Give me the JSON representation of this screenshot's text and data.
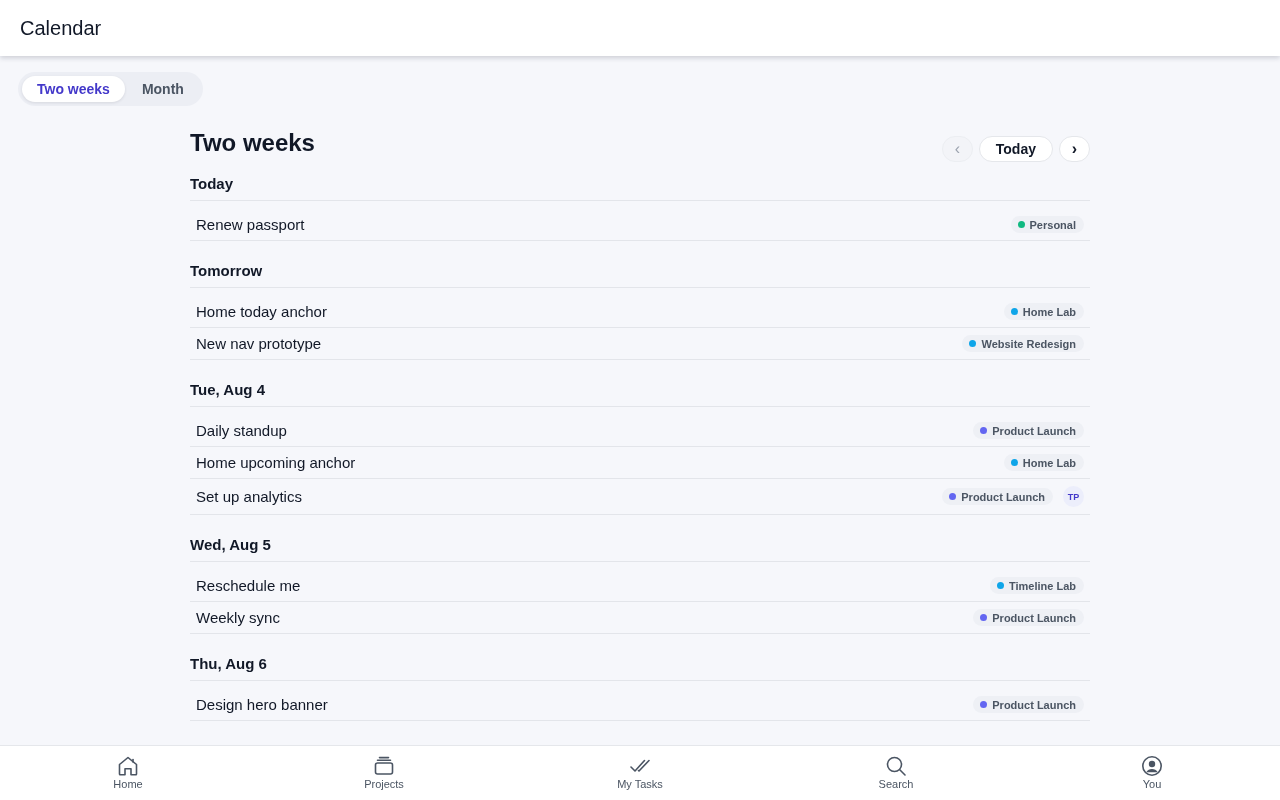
{
  "header": {
    "title": "Calendar"
  },
  "view_tabs": [
    {
      "label": "Two weeks",
      "selected": true
    },
    {
      "label": "Month",
      "selected": false
    }
  ],
  "main": {
    "title": "Two weeks",
    "nav": [
      {
        "kind": "prev",
        "label": "‹",
        "disabled": true
      },
      {
        "kind": "today",
        "label": "Today",
        "disabled": false
      },
      {
        "kind": "next",
        "label": "›",
        "disabled": false
      }
    ]
  },
  "days": [
    {
      "heading": "Today",
      "tasks": [
        {
          "title": "Renew passport",
          "project": {
            "name": "Personal",
            "color": "#10b981"
          }
        }
      ]
    },
    {
      "heading": "Tomorrow",
      "tasks": [
        {
          "title": "Home today anchor",
          "project": {
            "name": "Home Lab",
            "color": "#0ea5e9"
          }
        },
        {
          "title": "New nav prototype",
          "project": {
            "name": "Website Redesign",
            "color": "#0ea5e9"
          }
        }
      ]
    },
    {
      "heading": "Tue, Aug 4",
      "tasks": [
        {
          "title": "Daily standup",
          "project": {
            "name": "Product Launch",
            "color": "#6366f1"
          }
        },
        {
          "title": "Home upcoming anchor",
          "project": {
            "name": "Home Lab",
            "color": "#0ea5e9"
          }
        },
        {
          "title": "Set up analytics",
          "project": {
            "name": "Product Launch",
            "color": "#6366f1"
          },
          "assignee": "TP"
        }
      ]
    },
    {
      "heading": "Wed, Aug 5",
      "tasks": [
        {
          "title": "Reschedule me",
          "project": {
            "name": "Timeline Lab",
            "color": "#0ea5e9"
          }
        },
        {
          "title": "Weekly sync",
          "project": {
            "name": "Product Launch",
            "color": "#6366f1"
          }
        }
      ]
    },
    {
      "heading": "Thu, Aug 6",
      "tasks": [
        {
          "title": "Design hero banner",
          "project": {
            "name": "Product Launch",
            "color": "#6366f1"
          }
        }
      ]
    }
  ],
  "bottom_nav": [
    {
      "kind": "home",
      "label": "Home",
      "selected": false
    },
    {
      "kind": "projects",
      "label": "Projects",
      "selected": false
    },
    {
      "kind": "tasks",
      "label": "My Tasks",
      "selected": false
    },
    {
      "kind": "search",
      "label": "Search",
      "selected": false
    },
    {
      "kind": "profile",
      "label": "You",
      "selected": false
    }
  ]
}
